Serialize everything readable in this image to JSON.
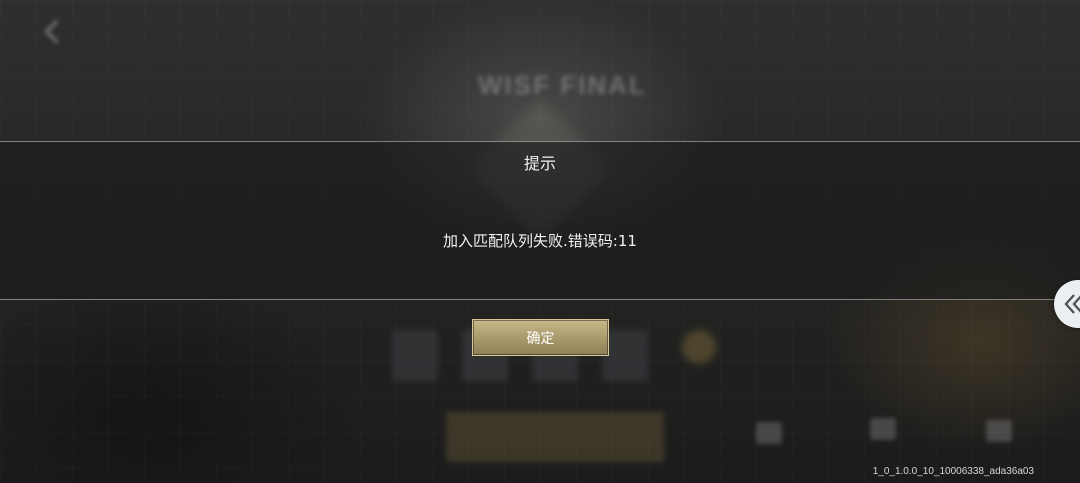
{
  "dialog": {
    "title": "提示",
    "message": "加入匹配队列失败.错误码:11",
    "confirm_label": "确定"
  },
  "background": {
    "title": "WISF FINAL"
  },
  "footer": {
    "version": "1_0_1.0.0_10_10006338_ada36a03"
  },
  "icons": {
    "side_tab": "double-chevron-left-icon",
    "back": "back-arrow-icon"
  },
  "colors": {
    "confirm_gold": "#b3a272",
    "side_tab_bg": "#eceff2"
  }
}
